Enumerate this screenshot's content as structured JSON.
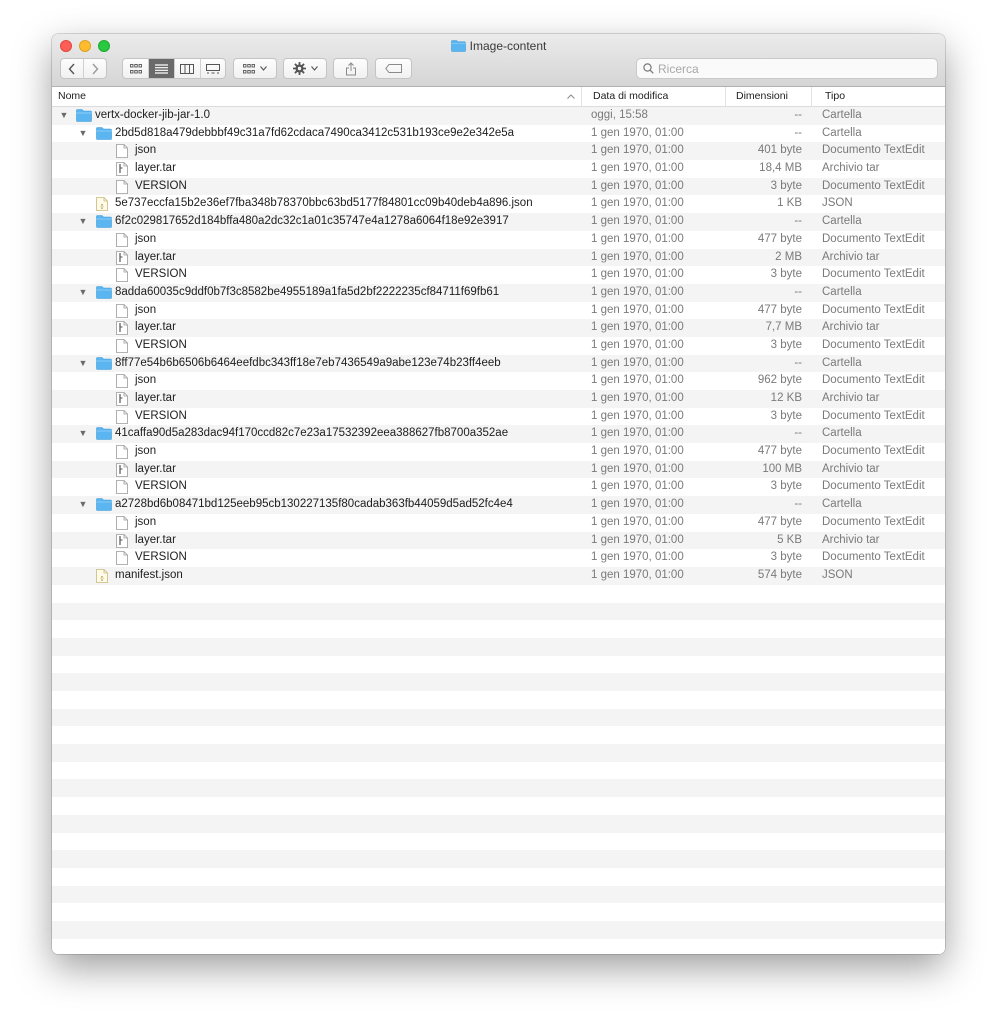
{
  "window": {
    "title": "Image-content"
  },
  "search": {
    "placeholder": "Ricerca",
    "value": ""
  },
  "columns": {
    "name": "Nome",
    "date": "Data di modifica",
    "size": "Dimensioni",
    "type": "Tipo"
  },
  "rows": [
    {
      "name": "vertx-docker-jib-jar-1.0",
      "date": "oggi, 15:58",
      "size": "--",
      "type": "Cartella",
      "level": 0,
      "icon": "folder-icon",
      "expanded": true
    },
    {
      "name": "2bd5d818a479debbbf49c31a7fd62cdaca7490ca3412c531b193ce9e2e342e5a",
      "date": "1 gen 1970, 01:00",
      "size": "--",
      "type": "Cartella",
      "level": 1,
      "icon": "folder-icon",
      "expanded": true
    },
    {
      "name": "json",
      "date": "1 gen 1970, 01:00",
      "size": "401 byte",
      "type": "Documento TextEdit",
      "level": 2,
      "icon": "document-icon"
    },
    {
      "name": "layer.tar",
      "date": "1 gen 1970, 01:00",
      "size": "18,4 MB",
      "type": "Archivio tar",
      "level": 2,
      "icon": "archive-icon"
    },
    {
      "name": "VERSION",
      "date": "1 gen 1970, 01:00",
      "size": "3 byte",
      "type": "Documento TextEdit",
      "level": 2,
      "icon": "document-icon"
    },
    {
      "name": "5e737eccfa15b2e36ef7fba348b78370bbc63bd5177f84801cc09b40deb4a896.json",
      "date": "1 gen 1970, 01:00",
      "size": "1 KB",
      "type": "JSON",
      "level": 1,
      "icon": "json-file-icon"
    },
    {
      "name": "6f2c029817652d184bffa480a2dc32c1a01c35747e4a1278a6064f18e92e3917",
      "date": "1 gen 1970, 01:00",
      "size": "--",
      "type": "Cartella",
      "level": 1,
      "icon": "folder-icon",
      "expanded": true
    },
    {
      "name": "json",
      "date": "1 gen 1970, 01:00",
      "size": "477 byte",
      "type": "Documento TextEdit",
      "level": 2,
      "icon": "document-icon"
    },
    {
      "name": "layer.tar",
      "date": "1 gen 1970, 01:00",
      "size": "2 MB",
      "type": "Archivio tar",
      "level": 2,
      "icon": "archive-icon"
    },
    {
      "name": "VERSION",
      "date": "1 gen 1970, 01:00",
      "size": "3 byte",
      "type": "Documento TextEdit",
      "level": 2,
      "icon": "document-icon"
    },
    {
      "name": "8adda60035c9ddf0b7f3c8582be4955189a1fa5d2bf2222235cf84711f69fb61",
      "date": "1 gen 1970, 01:00",
      "size": "--",
      "type": "Cartella",
      "level": 1,
      "icon": "folder-icon",
      "expanded": true
    },
    {
      "name": "json",
      "date": "1 gen 1970, 01:00",
      "size": "477 byte",
      "type": "Documento TextEdit",
      "level": 2,
      "icon": "document-icon"
    },
    {
      "name": "layer.tar",
      "date": "1 gen 1970, 01:00",
      "size": "7,7 MB",
      "type": "Archivio tar",
      "level": 2,
      "icon": "archive-icon"
    },
    {
      "name": "VERSION",
      "date": "1 gen 1970, 01:00",
      "size": "3 byte",
      "type": "Documento TextEdit",
      "level": 2,
      "icon": "document-icon"
    },
    {
      "name": "8ff77e54b6b6506b6464eefdbc343ff18e7eb7436549a9abe123e74b23ff4eeb",
      "date": "1 gen 1970, 01:00",
      "size": "--",
      "type": "Cartella",
      "level": 1,
      "icon": "folder-icon",
      "expanded": true
    },
    {
      "name": "json",
      "date": "1 gen 1970, 01:00",
      "size": "962 byte",
      "type": "Documento TextEdit",
      "level": 2,
      "icon": "document-icon"
    },
    {
      "name": "layer.tar",
      "date": "1 gen 1970, 01:00",
      "size": "12 KB",
      "type": "Archivio tar",
      "level": 2,
      "icon": "archive-icon"
    },
    {
      "name": "VERSION",
      "date": "1 gen 1970, 01:00",
      "size": "3 byte",
      "type": "Documento TextEdit",
      "level": 2,
      "icon": "document-icon"
    },
    {
      "name": "41caffa90d5a283dac94f170ccd82c7e23a17532392eea388627fb8700a352ae",
      "date": "1 gen 1970, 01:00",
      "size": "--",
      "type": "Cartella",
      "level": 1,
      "icon": "folder-icon",
      "expanded": true
    },
    {
      "name": "json",
      "date": "1 gen 1970, 01:00",
      "size": "477 byte",
      "type": "Documento TextEdit",
      "level": 2,
      "icon": "document-icon"
    },
    {
      "name": "layer.tar",
      "date": "1 gen 1970, 01:00",
      "size": "100 MB",
      "type": "Archivio tar",
      "level": 2,
      "icon": "archive-icon"
    },
    {
      "name": "VERSION",
      "date": "1 gen 1970, 01:00",
      "size": "3 byte",
      "type": "Documento TextEdit",
      "level": 2,
      "icon": "document-icon"
    },
    {
      "name": "a2728bd6b08471bd125eeb95cb130227135f80cadab363fb44059d5ad52fc4e4",
      "date": "1 gen 1970, 01:00",
      "size": "--",
      "type": "Cartella",
      "level": 1,
      "icon": "folder-icon",
      "expanded": true
    },
    {
      "name": "json",
      "date": "1 gen 1970, 01:00",
      "size": "477 byte",
      "type": "Documento TextEdit",
      "level": 2,
      "icon": "document-icon"
    },
    {
      "name": "layer.tar",
      "date": "1 gen 1970, 01:00",
      "size": "5 KB",
      "type": "Archivio tar",
      "level": 2,
      "icon": "archive-icon"
    },
    {
      "name": "VERSION",
      "date": "1 gen 1970, 01:00",
      "size": "3 byte",
      "type": "Documento TextEdit",
      "level": 2,
      "icon": "document-icon"
    },
    {
      "name": "manifest.json",
      "date": "1 gen 1970, 01:00",
      "size": "574 byte",
      "type": "JSON",
      "level": 1,
      "icon": "json-file-icon"
    }
  ],
  "colors": {
    "folder": "#5bb5f0",
    "stripe": "#f4f4f4",
    "close": "#fd5f57",
    "minimize": "#febc2e",
    "zoom": "#28c840"
  }
}
